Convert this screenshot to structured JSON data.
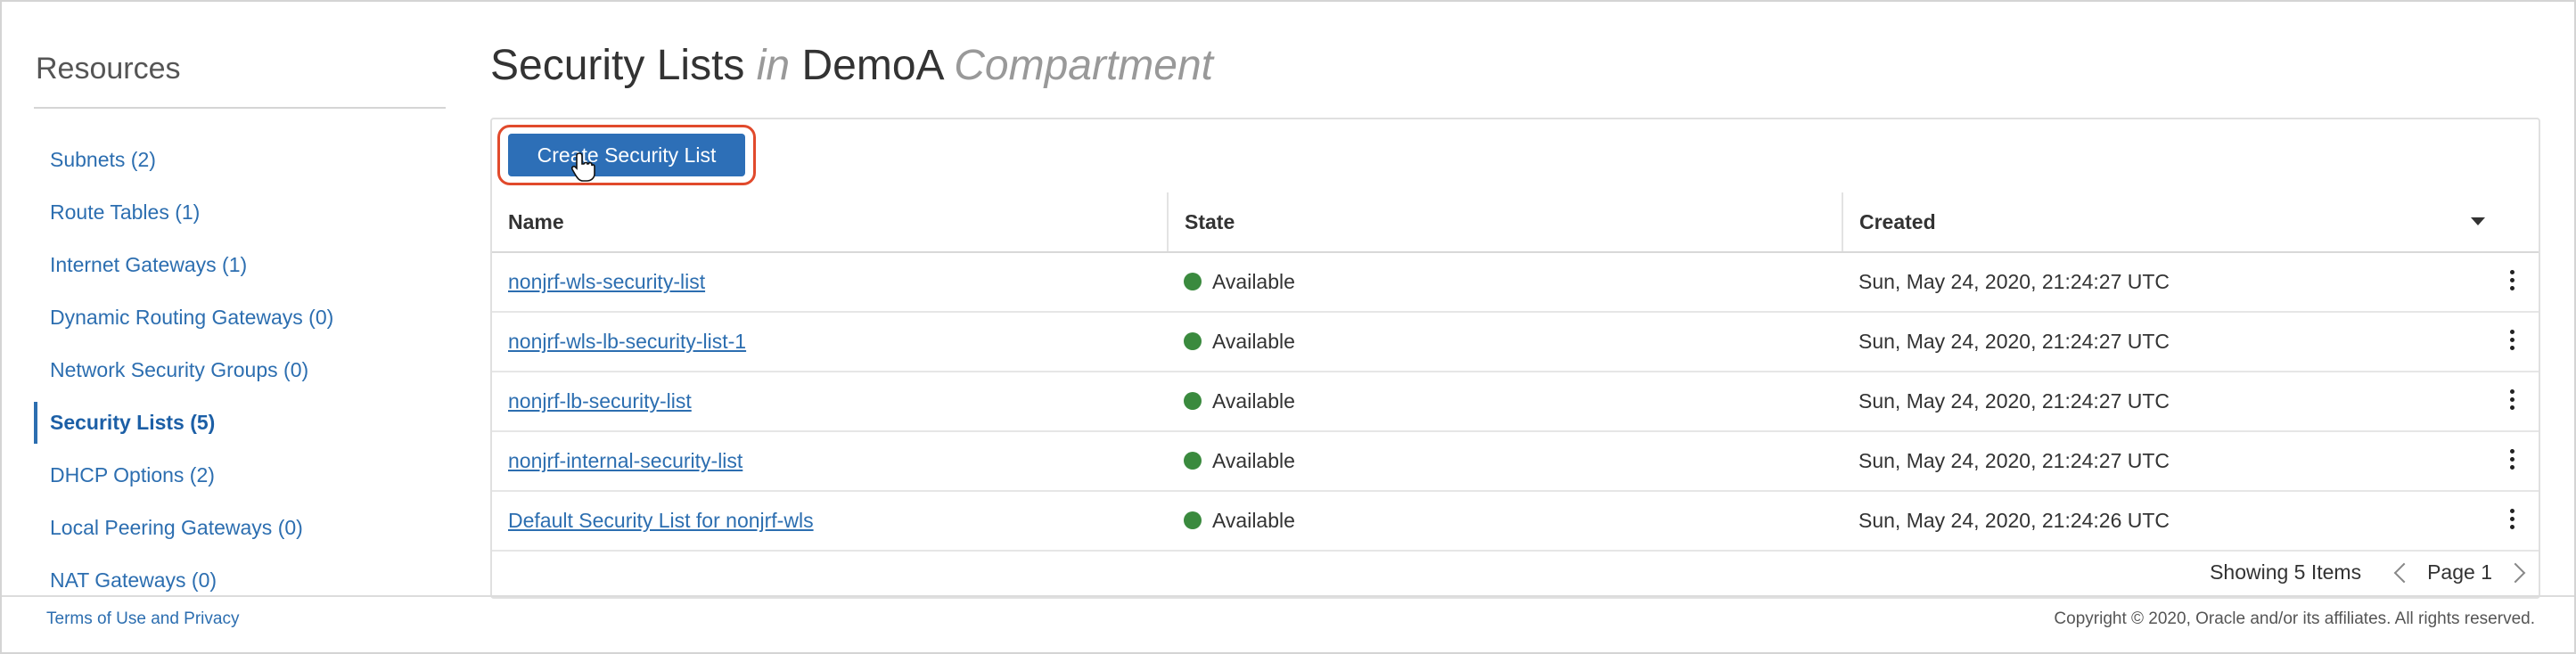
{
  "sidebar": {
    "title": "Resources",
    "items": [
      {
        "label": "Subnets (2)",
        "active": false
      },
      {
        "label": "Route Tables (1)",
        "active": false
      },
      {
        "label": "Internet Gateways (1)",
        "active": false
      },
      {
        "label": "Dynamic Routing Gateways (0)",
        "active": false
      },
      {
        "label": "Network Security Groups (0)",
        "active": false
      },
      {
        "label": "Security Lists (5)",
        "active": true
      },
      {
        "label": "DHCP Options (2)",
        "active": false
      },
      {
        "label": "Local Peering Gateways (0)",
        "active": false
      },
      {
        "label": "NAT Gateways (0)",
        "active": false
      }
    ]
  },
  "page": {
    "title_main": "Security Lists",
    "title_in": "in",
    "compartment": "DemoA",
    "compartment_word": "Compartment"
  },
  "toolbar": {
    "create_label": "Create Security List"
  },
  "table": {
    "columns": [
      "Name",
      "State",
      "Created"
    ],
    "rows": [
      {
        "name": "nonjrf-wls-security-list",
        "state": "Available",
        "created": "Sun, May 24, 2020, 21:24:27 UTC"
      },
      {
        "name": "nonjrf-wls-lb-security-list-1",
        "state": "Available",
        "created": "Sun, May 24, 2020, 21:24:27 UTC"
      },
      {
        "name": "nonjrf-lb-security-list",
        "state": "Available",
        "created": "Sun, May 24, 2020, 21:24:27 UTC"
      },
      {
        "name": "nonjrf-internal-security-list",
        "state": "Available",
        "created": "Sun, May 24, 2020, 21:24:27 UTC"
      },
      {
        "name": "Default Security List for nonjrf-wls",
        "state": "Available",
        "created": "Sun, May 24, 2020, 21:24:26 UTC"
      }
    ]
  },
  "pager": {
    "showing": "Showing 5 Items",
    "page": "Page 1"
  },
  "footer": {
    "terms": "Terms of Use and Privacy",
    "copyright": "Copyright © 2020, Oracle and/or its affiliates. All rights reserved."
  },
  "icons": {
    "sort": "caret-down-icon",
    "row_actions": "kebab-menu-icon",
    "status": "green-dot-icon",
    "prev": "chevron-left-icon",
    "next": "chevron-right-icon",
    "cursor": "hand-pointer-icon"
  },
  "colors": {
    "accent": "#2d6fb7",
    "link": "#2c6eb0",
    "available": "#3a8a3e",
    "highlight_ring": "#e14a2c"
  }
}
